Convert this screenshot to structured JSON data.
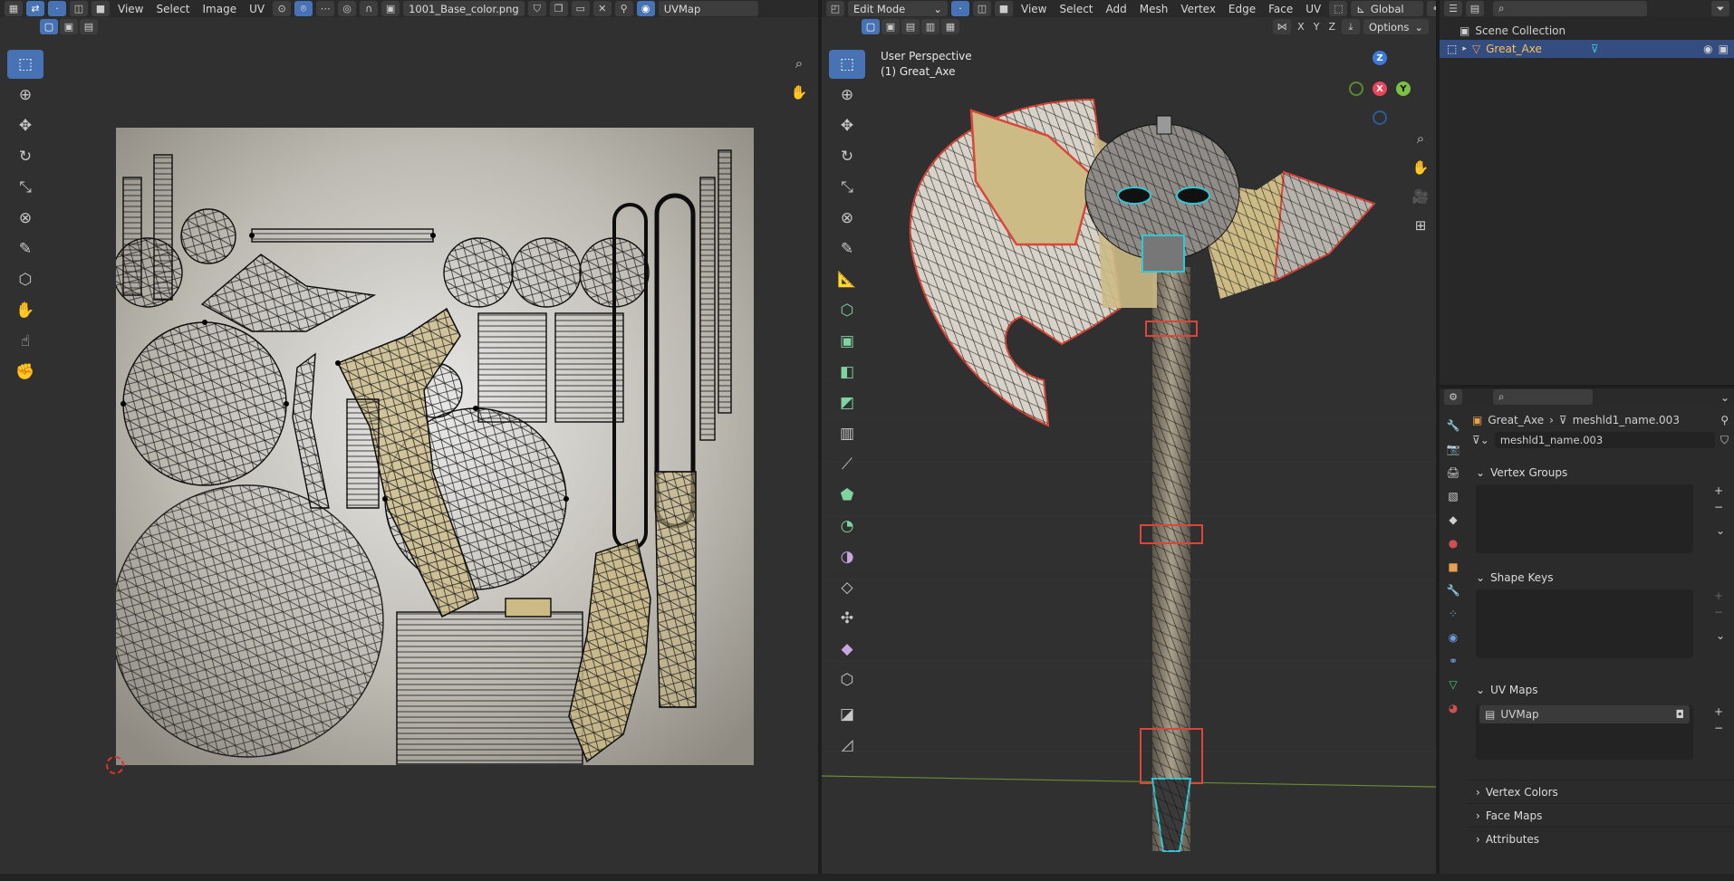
{
  "uv_editor": {
    "header": {
      "menus": [
        "View",
        "Select",
        "Image",
        "UV"
      ],
      "image_name": "1001_Base_color.png",
      "uv_map": "UVMap"
    },
    "tools": [
      "select-box",
      "cursor",
      "move",
      "rotate",
      "scale",
      "transform",
      "annotate",
      "rip",
      "grab",
      "relax",
      "pinch"
    ]
  },
  "viewport": {
    "header": {
      "mode": "Edit Mode",
      "menus": [
        "View",
        "Select",
        "Add",
        "Mesh",
        "Vertex",
        "Edge",
        "Face",
        "UV"
      ],
      "orientation": "Global",
      "options_label": "Options",
      "axis_x": "X",
      "axis_y": "Y",
      "axis_z": "Z"
    },
    "overlay": {
      "view_name": "User Perspective",
      "object_name": "(1) Great_Axe"
    },
    "gizmo": {
      "x": "X",
      "y": "Y",
      "z": "Z"
    }
  },
  "outliner": {
    "collection": "Scene Collection",
    "object": "Great_Axe"
  },
  "properties": {
    "breadcrumb_object": "Great_Axe",
    "breadcrumb_mesh": "meshld1_name.003",
    "mesh_name": "meshld1_name.003",
    "panels": {
      "vertex_groups": "Vertex Groups",
      "shape_keys": "Shape Keys",
      "uv_maps": "UV Maps",
      "uv_map_item": "UVMap",
      "vertex_colors": "Vertex Colors",
      "face_maps": "Face Maps",
      "attributes": "Attributes"
    }
  },
  "colors": {
    "accent": "#4772b3",
    "editor_bg": "#303030",
    "header_bg": "#2a2a2a",
    "seam_red": "#d9473b",
    "sharp_cyan": "#35c6d6",
    "uv_fill": "#cdbb86"
  }
}
